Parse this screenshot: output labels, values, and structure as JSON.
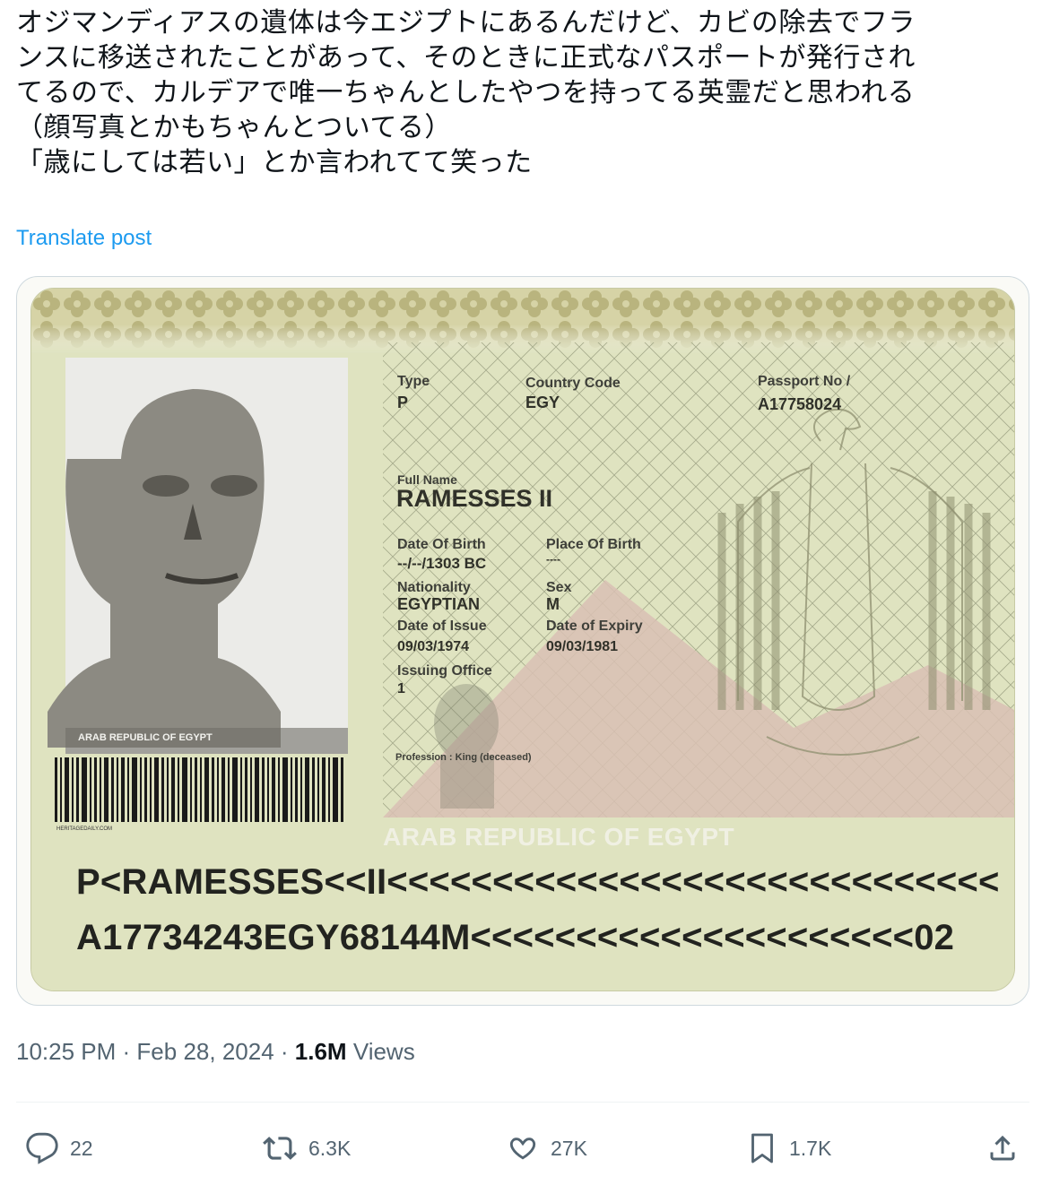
{
  "post": {
    "text_lines": [
      "オジマンディアスの遺体は今エジプトにあるんだけど、カビの除去でフラ",
      "ンスに移送されたことがあって、そのときに正式なパスポートが発行され",
      "てるので、カルデアで唯一ちゃんとしたやつを持ってる英霊だと思われる",
      "（顔写真とかもちゃんとついてる）",
      "「歳にしては若い」とか言われてて笑った"
    ],
    "translate_label": "Translate post"
  },
  "passport": {
    "type_label": "Type",
    "type_value": "P",
    "country_code_label": "Country Code",
    "country_code_value": "EGY",
    "passport_no_label": "Passport No /",
    "passport_no_value": "A17758024",
    "full_name_label": "Full Name",
    "full_name_value": "RAMESSES II",
    "dob_label": "Date Of Birth",
    "dob_value": "--/--/1303 BC",
    "pob_label": "Place Of Birth",
    "pob_value": "----",
    "nationality_label": "Nationality",
    "nationality_value": "EGYPTIAN",
    "sex_label": "Sex",
    "sex_value": "M",
    "issue_label": "Date of Issue",
    "issue_value": "09/03/1974",
    "expiry_label": "Date of Expiry",
    "expiry_value": "09/03/1981",
    "office_label": "Issuing Office",
    "office_value": "1",
    "profession_text": "Profession : King (deceased)",
    "watermark": "ARAB REPUBLIC OF EGYPT",
    "photo_watermark": "ARAB REPUBLIC OF EGYPT",
    "barcode_caption": "HERITAGEDAILY.COM",
    "mrz_line1": "P<RAMESSES<<II<<<<<<<<<<<<<<<<<<<<<<<<<<<<<",
    "mrz_line2": "A17734243EGY68144M<<<<<<<<<<<<<<<<<<<<<02"
  },
  "meta": {
    "time": "10:25 PM",
    "date": "Feb 28, 2024",
    "views_count": "1.6M",
    "views_label": "Views"
  },
  "actions": {
    "replies": "22",
    "reposts": "6.3K",
    "likes": "27K",
    "bookmarks": "1.7K"
  },
  "colors": {
    "link": "#1d9bf0",
    "muted": "#536471",
    "card_bg": "#dfe3c0",
    "card_band": "#c8c595",
    "pyramid": "#d9bfb4"
  }
}
